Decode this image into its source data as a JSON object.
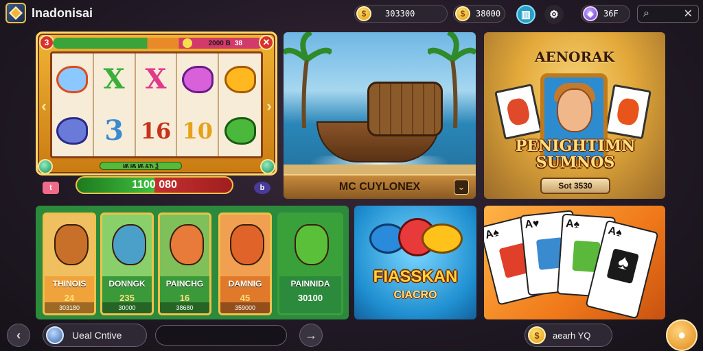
{
  "app": {
    "title": "Inadonisai",
    "logo_icon": "gem-icon"
  },
  "header": {
    "balance_primary": "303300",
    "balance_secondary": "38000",
    "gems_value": "36F",
    "chest_icon": "treasure-icon",
    "settings_icon": "gear-icon",
    "search_icon": "search-icon",
    "close_icon": "close-icon"
  },
  "slot_machine": {
    "badge": "3",
    "header_text": "2000 B",
    "header_symbol": "38",
    "reels_row1": [
      "",
      "X",
      "X",
      "",
      ""
    ],
    "reels_row2": [
      "",
      "3",
      "16",
      "10",
      ""
    ],
    "bottom_label": "Ѭ Ѭ Ѭ ѦЋ Ѯ",
    "balance": "1100 080",
    "left_tag": "t",
    "right_tag": "b",
    "colors": {
      "frame": "#f0b433",
      "balance_green": "#3fbf3f",
      "balance_red": "#c43030"
    }
  },
  "pirate_card": {
    "title": "MC CUYLONEX",
    "play_icon": "chevron-down-icon"
  },
  "hero_card": {
    "title_top": "AENORAK",
    "title": "PENIGHTIMN SUMNOS",
    "button": "Sot 3530"
  },
  "tiles": [
    {
      "name": "THINOIS",
      "sub": "24",
      "foot": "303180",
      "color": "#f0a33a",
      "art": "#c8702a"
    },
    {
      "name": "DONNGK",
      "sub": "235",
      "foot": "30000",
      "color": "#8ad06a",
      "art": "#4aa0c8"
    },
    {
      "name": "PAINCHG",
      "sub": "16",
      "foot": "38680",
      "color": "#7fc05a",
      "art": "#e87a3a"
    },
    {
      "name": "DAMNIG",
      "sub": "45",
      "foot": "359000",
      "color": "#f07a2a",
      "art": "#e0642a"
    },
    {
      "name": "PAINNIDA",
      "sub": "30100",
      "foot": "",
      "color": "#3aa03a",
      "art": "#5ac03a"
    }
  ],
  "fish_card": {
    "title": "FIASSKAN",
    "subtitle": "CIACRO"
  },
  "footer": {
    "back_icon": "chevron-left-icon",
    "user_label": "Ueal Cntive",
    "chat_placeholder": "",
    "send_icon": "arrow-right-icon",
    "coin_label": "aearh YQ",
    "bag_icon": "bag-icon"
  }
}
